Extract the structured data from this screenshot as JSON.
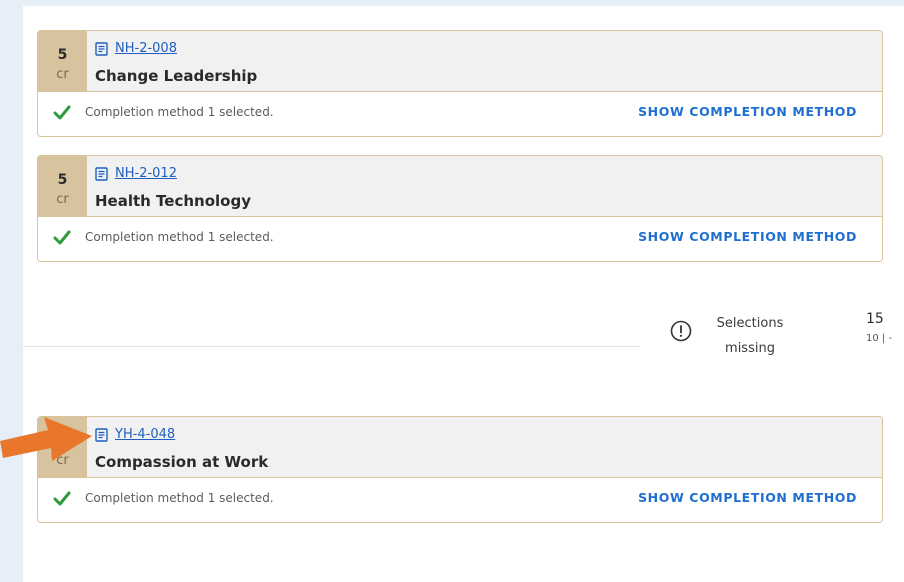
{
  "courses": [
    {
      "credits": "5",
      "credit_unit": "cr",
      "code": "NH-2-008",
      "title": "Change Leadership",
      "completion_text": "Completion method 1 selected.",
      "action_label": "SHOW COMPLETION METHOD"
    },
    {
      "credits": "5",
      "credit_unit": "cr",
      "code": "NH-2-012",
      "title": "Health Technology",
      "completion_text": "Completion method 1 selected.",
      "action_label": "SHOW COMPLETION METHOD"
    },
    {
      "credits": "",
      "credit_unit": "cr",
      "code": "YH-4-048",
      "title": "Compassion at Work",
      "completion_text": "Completion method 1 selected.",
      "action_label": "SHOW COMPLETION METHOD"
    }
  ],
  "status": {
    "icon": "alert-circle-icon",
    "label": "Selections missing",
    "value": "15",
    "sub": "10 | -"
  },
  "colors": {
    "accent": "#1e6fd0",
    "credit_bg": "#d8c39f",
    "check": "#2e9a3a",
    "annotation_arrow": "#e8762b"
  },
  "icons": {
    "doc": "document-icon",
    "check": "check-icon",
    "arrow": "annotation-arrow"
  }
}
